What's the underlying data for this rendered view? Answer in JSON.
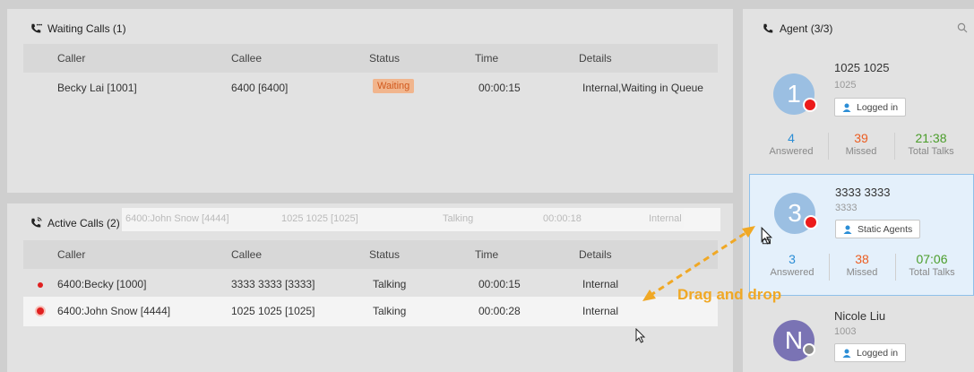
{
  "waiting": {
    "title": "Waiting Calls (1)",
    "headers": [
      "Caller",
      "Callee",
      "Status",
      "Time",
      "Details"
    ],
    "rows": [
      {
        "caller": "Becky Lai [1001]",
        "callee": "6400 [6400]",
        "status": "Waiting",
        "time": "00:00:15",
        "details": "Internal,Waiting in Queue"
      }
    ]
  },
  "active": {
    "title": "Active Calls (2)",
    "headers": [
      "Caller",
      "Callee",
      "Status",
      "Time",
      "Details"
    ],
    "rows": [
      {
        "caller": "6400:Becky [1000]",
        "callee": "3333 3333 [3333]",
        "status": "Talking",
        "time": "00:00:15",
        "details": "Internal"
      },
      {
        "caller": "6400:John Snow [4444]",
        "callee": "1025 1025 [1025]",
        "status": "Talking",
        "time": "00:00:28",
        "details": "Internal"
      }
    ],
    "drag_ghost": {
      "caller": "6400:John Snow [4444]",
      "callee": "1025 1025 [1025]",
      "status": "Talking",
      "time": "00:00:18",
      "details": "Internal"
    }
  },
  "agents": {
    "title": "Agent (3/3)",
    "items": [
      {
        "initial": "1",
        "name": "1025 1025",
        "ext": "1025",
        "tag": "Logged in",
        "answered": "4",
        "missed": "39",
        "talks": "21:38",
        "answered_label": "Answered",
        "missed_label": "Missed",
        "talks_label": "Total Talks"
      },
      {
        "initial": "3",
        "name": "3333 3333",
        "ext": "3333",
        "tag": "Static Agents",
        "answered": "3",
        "missed": "38",
        "talks": "07:06",
        "answered_label": "Answered",
        "missed_label": "Missed",
        "talks_label": "Total Talks"
      },
      {
        "initial": "N",
        "name": "Nicole Liu",
        "ext": "1003",
        "tag": "Logged in"
      }
    ]
  },
  "annotation": {
    "drag_and_drop": "Drag and drop"
  },
  "colors": {
    "accent_blue": "#2c8ed6",
    "missed": "#ec5d21",
    "talks": "#4a9d2a",
    "annotation": "#f0a825"
  }
}
